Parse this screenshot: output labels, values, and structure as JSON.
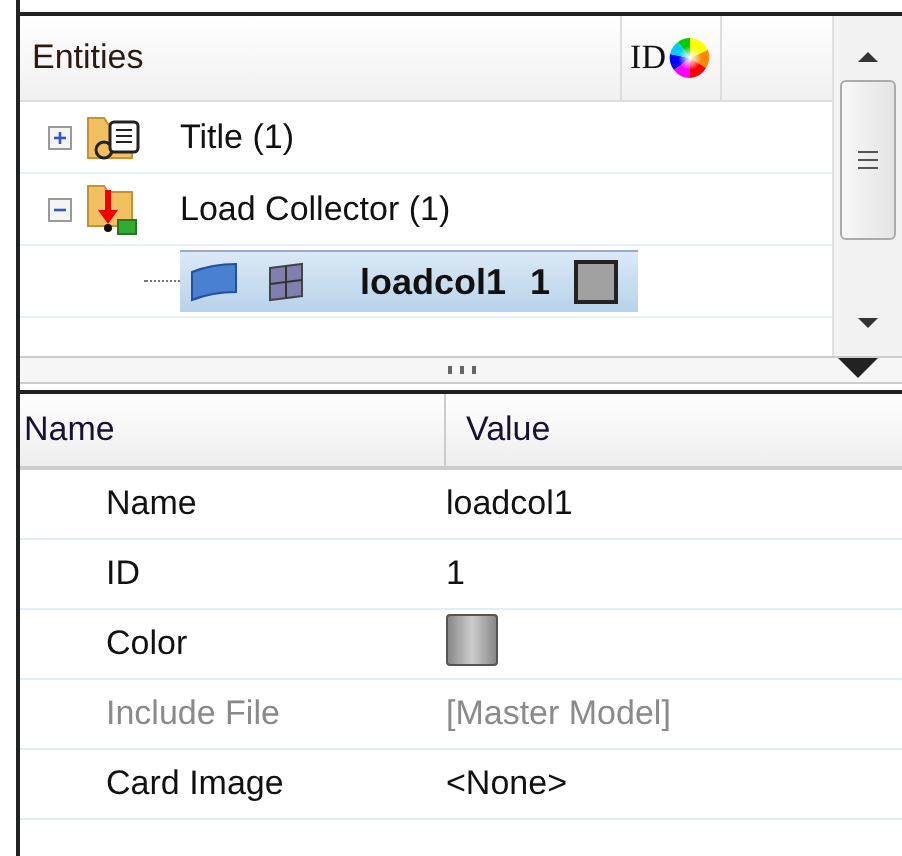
{
  "entities_panel": {
    "header": {
      "title": "Entities",
      "id_label": "ID"
    },
    "tree": [
      {
        "label": "Title (1)",
        "kind": "note",
        "expanded": false,
        "selected": false
      },
      {
        "label": "Load Collector (1)",
        "kind": "load",
        "expanded": true,
        "selected": false,
        "children": [
          {
            "label": "loadcol1",
            "id": "1",
            "selected": true
          }
        ]
      }
    ]
  },
  "properties": {
    "columns": [
      "Name",
      "Value"
    ],
    "rows": [
      {
        "name": "Name",
        "kind": "text",
        "value": "loadcol1",
        "disabled": false
      },
      {
        "name": "ID",
        "kind": "text",
        "value": "1",
        "disabled": false
      },
      {
        "name": "Color",
        "kind": "color",
        "disabled": false
      },
      {
        "name": "Include File",
        "kind": "text",
        "value": "[Master Model]",
        "disabled": true
      },
      {
        "name": "Card Image",
        "kind": "text",
        "value": "<None>",
        "disabled": false
      }
    ]
  }
}
